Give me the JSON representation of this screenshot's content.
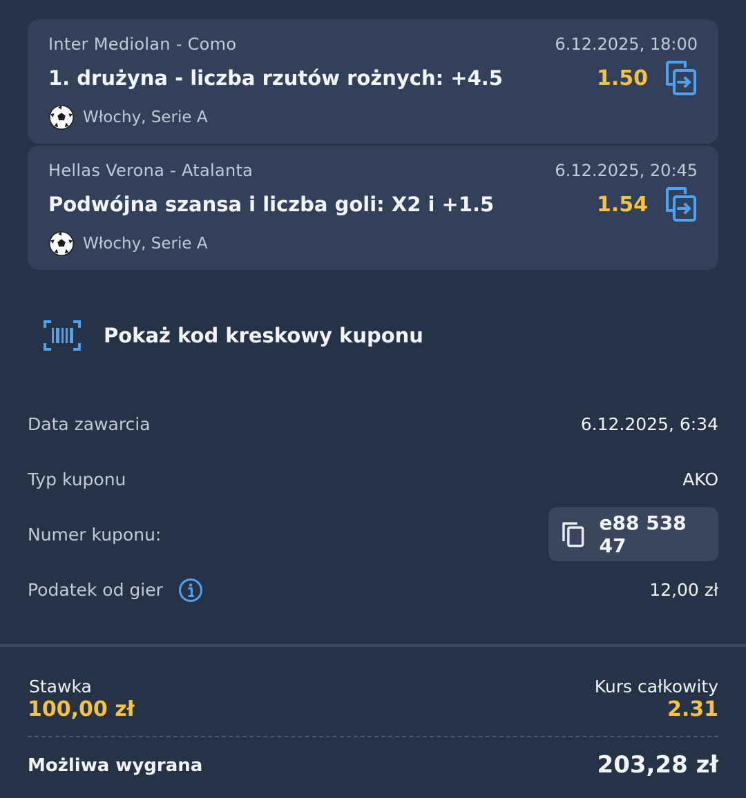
{
  "bets": [
    {
      "match": "Inter Mediolan - Como",
      "datetime": "6.12.2025, 18:00",
      "market": "1. drużyna - liczba rzutów rożnych: +4.5",
      "odds": "1.50",
      "league": "Włochy, Serie A",
      "sport_icon": "soccer-ball-icon",
      "action_icon": "swap-icon"
    },
    {
      "match": "Hellas Verona - Atalanta",
      "datetime": "6.12.2025, 20:45",
      "market": "Podwójna szansa i liczba goli: X2 i +1.5",
      "odds": "1.54",
      "league": "Włochy, Serie A",
      "sport_icon": "soccer-ball-icon",
      "action_icon": "swap-icon"
    }
  ],
  "barcode": {
    "label": "Pokaż kod kreskowy kuponu",
    "icon": "barcode-icon"
  },
  "details": {
    "date_label": "Data zawarcia",
    "date_value": "6.12.2025, 6:34",
    "type_label": "Typ kuponu",
    "type_value": "AKO",
    "number_label": "Numer kuponu:",
    "number_value": "e88 538 47",
    "tax_label": "Podatek od gier",
    "tax_value": "12,00 zł"
  },
  "summary": {
    "stake_label": "Stawka",
    "stake_value": "100,00 zł",
    "total_odds_label": "Kurs całkowity",
    "total_odds_value": "2.31",
    "win_label": "Możliwa wygrana",
    "win_value": "203,28 zł"
  },
  "colors": {
    "background": "#263246",
    "card": "#33405a",
    "accent_yellow": "#f5c242",
    "accent_blue": "#4da3f0"
  }
}
